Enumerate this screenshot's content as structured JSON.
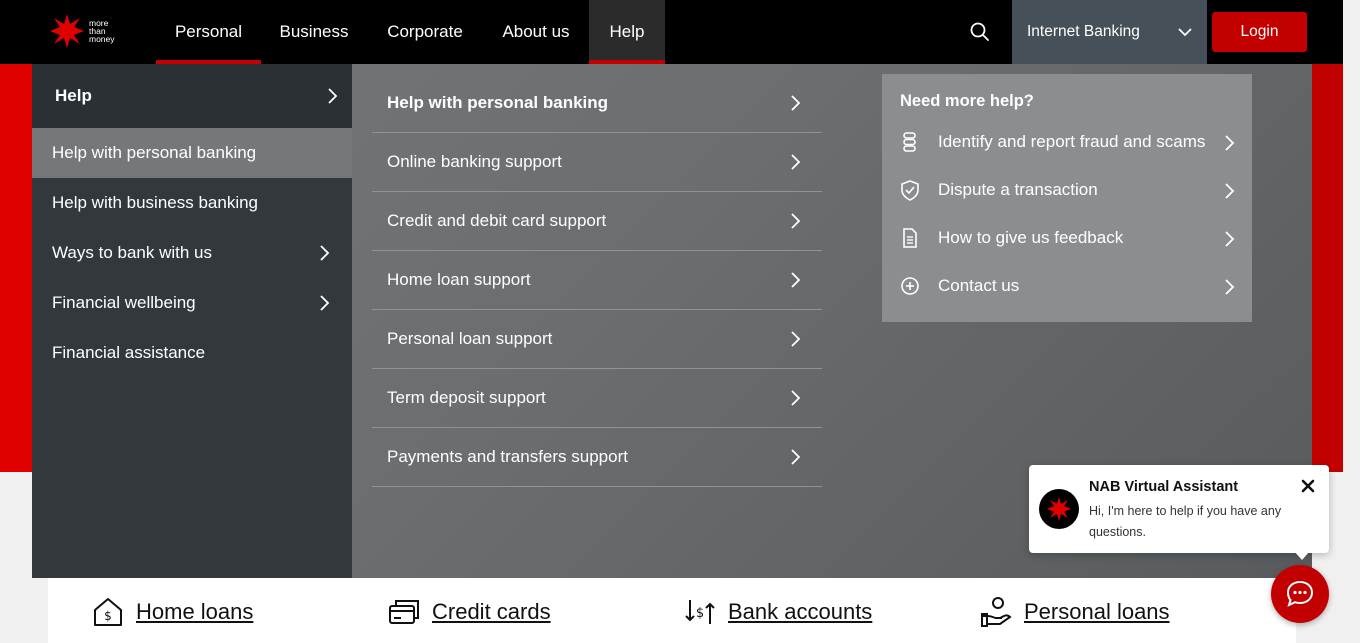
{
  "brand": {
    "logo_lines": [
      "more",
      "than",
      "money"
    ],
    "accent": "#c20000"
  },
  "topnav": {
    "items": [
      {
        "label": "Personal"
      },
      {
        "label": "Business"
      },
      {
        "label": "Corporate"
      },
      {
        "label": "About us"
      },
      {
        "label": "Help"
      }
    ],
    "internet_banking": "Internet Banking",
    "login": "Login"
  },
  "mega_menu": {
    "heading": "Help",
    "left_items": [
      {
        "label": "Help with personal banking",
        "has_submenu": false,
        "active": true
      },
      {
        "label": "Help with business banking",
        "has_submenu": false
      },
      {
        "label": "Ways to bank with us",
        "has_submenu": true
      },
      {
        "label": "Financial wellbeing",
        "has_submenu": true
      },
      {
        "label": "Financial assistance",
        "has_submenu": false
      }
    ],
    "middle_items": [
      {
        "label": "Help with personal banking"
      },
      {
        "label": "Online banking support"
      },
      {
        "label": "Credit and debit card support"
      },
      {
        "label": "Home loan support"
      },
      {
        "label": "Personal loan support"
      },
      {
        "label": "Term deposit support"
      },
      {
        "label": "Payments and transfers support"
      }
    ],
    "more_help": {
      "title": "Need more help?",
      "items": [
        {
          "label": "Identify and report fraud and scams",
          "icon": "fraud-icon"
        },
        {
          "label": "Dispute a transaction",
          "icon": "shield-check-icon"
        },
        {
          "label": "How to give us feedback",
          "icon": "document-icon"
        },
        {
          "label": "Contact us",
          "icon": "plus-circle-icon"
        }
      ]
    }
  },
  "quick_links": [
    {
      "label": "Home loans",
      "icon": "house-dollar-icon"
    },
    {
      "label": "Credit cards",
      "icon": "credit-card-icon"
    },
    {
      "label": "Bank accounts",
      "icon": "transfer-icon"
    },
    {
      "label": "Personal loans",
      "icon": "hand-coins-icon"
    }
  ],
  "virtual_assistant": {
    "title": "NAB Virtual Assistant",
    "message": "Hi, I'm here to help if you have any questions."
  }
}
